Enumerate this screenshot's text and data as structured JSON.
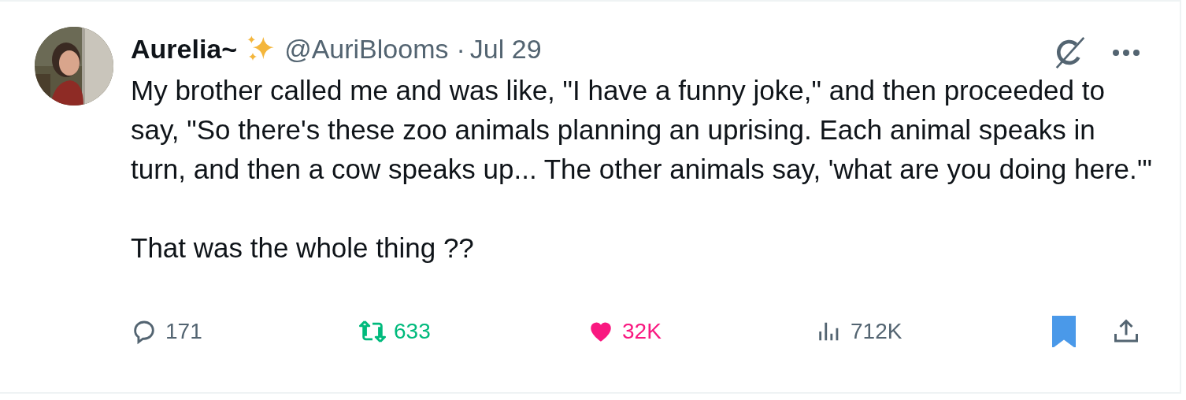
{
  "author": {
    "name": "Aurelia~",
    "handle": "@AuriBlooms",
    "separator": "·",
    "date": "Jul 29"
  },
  "paragraphs": [
    "My brother called me and was like, \"I have a funny joke,\" and then proceeded to say, \"So there's these zoo animals planning an uprising. Each animal speaks in turn, and then a cow speaks up... The other animals say, 'what are you doing here.'\"",
    "That was the whole thing ??"
  ],
  "actions": [
    {
      "kind": "reply",
      "count": "171"
    },
    {
      "kind": "repost",
      "count": "633",
      "active": true
    },
    {
      "kind": "like",
      "count": "32K",
      "active": true
    },
    {
      "kind": "views",
      "count": "712K"
    }
  ],
  "bookmarked": true
}
